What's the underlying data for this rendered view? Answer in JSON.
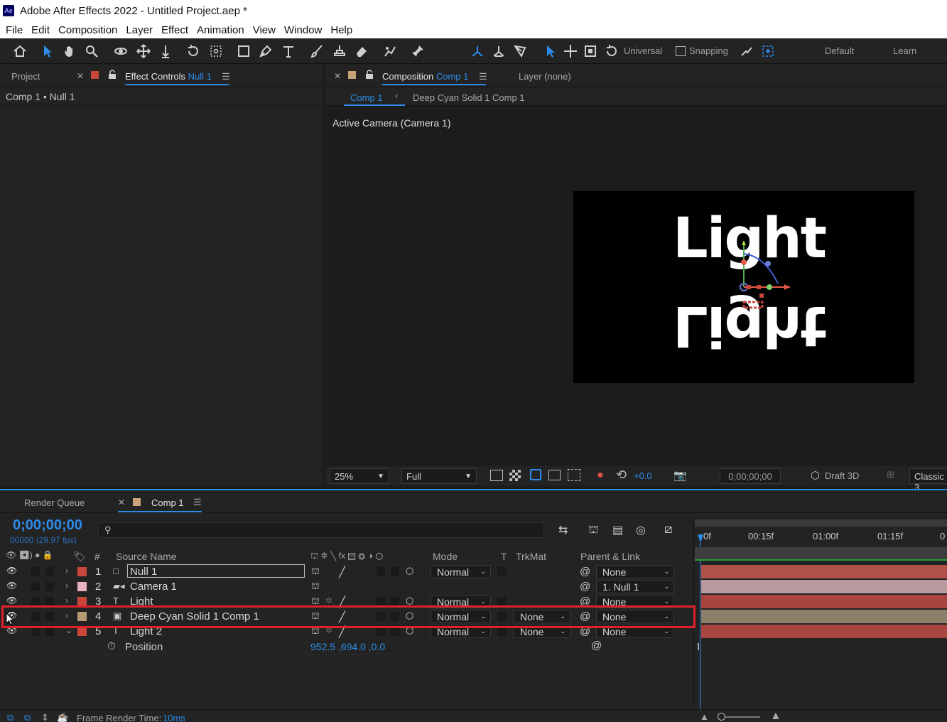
{
  "window": {
    "title": "Adobe After Effects 2022 - Untitled Project.aep *",
    "logo": "Ae"
  },
  "menu": [
    "File",
    "Edit",
    "Composition",
    "Layer",
    "Effect",
    "Animation",
    "View",
    "Window",
    "Help"
  ],
  "toolbar": {
    "universal_label": "Universal",
    "snapping_label": "Snapping",
    "workspace_default": "Default",
    "workspace_learn": "Learn"
  },
  "project_panel": {
    "tab_project": "Project",
    "tab_effect_controls": "Effect Controls",
    "tab_effect_controls_target": "Null 1",
    "breadcrumb": "Comp 1 • Null 1"
  },
  "comp_panel": {
    "tab_composition": "Composition",
    "tab_composition_name": "Comp 1",
    "tab_layer": "Layer (none)",
    "crumb_active": "Comp 1",
    "crumb_other": "Deep Cyan Solid 1 Comp 1",
    "camera_label": "Active Camera (Camera 1)",
    "canvas_text": "Light",
    "canvas_text_mirrored": "Light",
    "zoom": "25%",
    "resolution": "Full",
    "exposure": "+0.0",
    "timecode": "0;00;00;00",
    "renderer": "Draft 3D",
    "renderer_mode": "Classic 3"
  },
  "timeline": {
    "tab_render_queue": "Render Queue",
    "tab_comp": "Comp 1",
    "current_time": "0;00;00;00",
    "frame_info": "00000 (29.97 fps)",
    "search_placeholder": "",
    "headers": {
      "num": "#",
      "source_name": "Source Name",
      "mode": "Mode",
      "t": "T",
      "trkmat": "TrkMat",
      "parent": "Parent & Link"
    },
    "ruler": [
      "0f",
      "00:15f",
      "01:00f",
      "01:15f",
      "0"
    ],
    "layers": [
      {
        "num": "1",
        "name": "Null 1",
        "type": "null",
        "color": "#c8463a",
        "mode": "Normal",
        "trkmat": "",
        "parent": "None",
        "bar": "#b0504a"
      },
      {
        "num": "2",
        "name": "Camera 1",
        "type": "camera",
        "color": "#e8b4c0",
        "mode": "",
        "trkmat": "",
        "parent": "1. Null 1",
        "bar": "#b89a9e"
      },
      {
        "num": "3",
        "name": "Light",
        "type": "text",
        "color": "#c8463a",
        "mode": "Normal",
        "trkmat": "",
        "parent": "None",
        "bar": "#a8453f"
      },
      {
        "num": "4",
        "name": "Deep Cyan Solid 1 Comp 1",
        "type": "precomp",
        "color": "#b59a72",
        "mode": "Normal",
        "trkmat": "None",
        "parent": "None",
        "bar": "#8d806a"
      },
      {
        "num": "5",
        "name": "Light 2",
        "type": "text",
        "color": "#c8463a",
        "mode": "Normal",
        "trkmat": "None",
        "parent": "None",
        "bar": "#a8453f"
      }
    ],
    "property": {
      "name": "Position",
      "value_x": "952.5",
      "value_y": "694.0",
      "value_z": "0.0"
    },
    "footer_label": "Frame Render Time:",
    "footer_value": "10ms"
  },
  "colors": {
    "accent": "#2d8ceb",
    "highlight": "#e0202a",
    "panel_bg": "#232323"
  }
}
